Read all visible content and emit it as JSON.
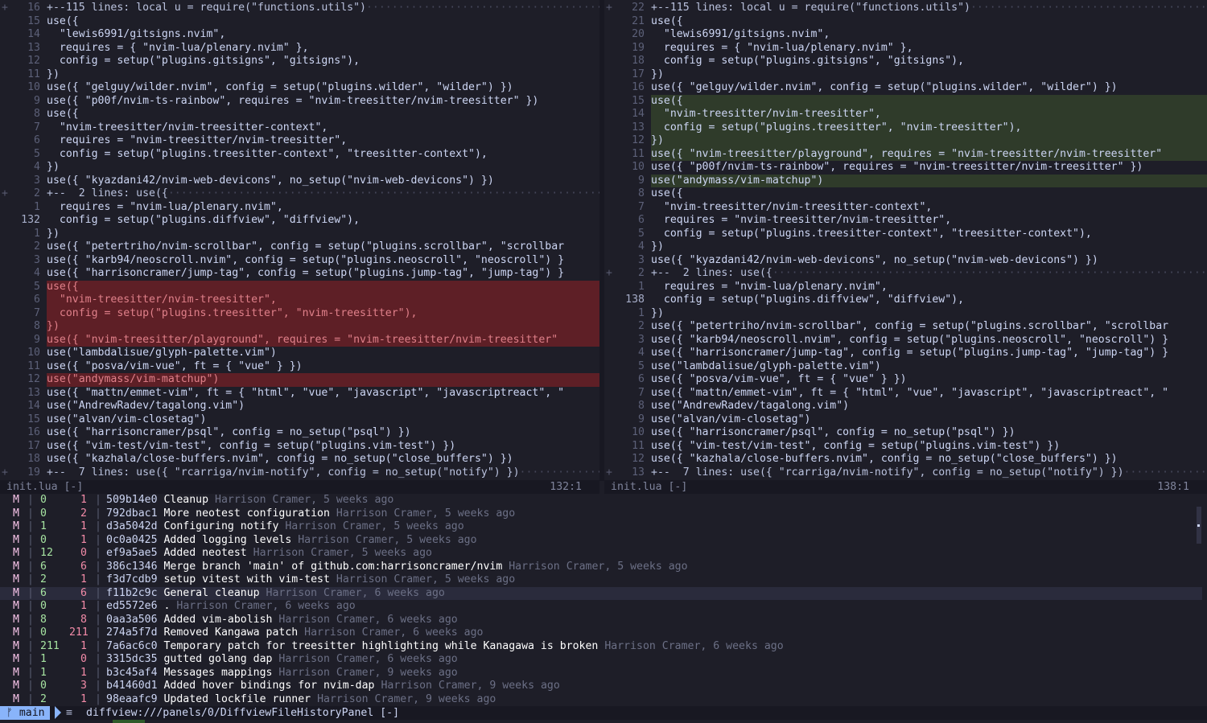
{
  "left": {
    "lines": [
      {
        "sign": "+",
        "num": "16",
        "code": "+--115 lines: local u = require(\"functions.utils\")",
        "type": "fold"
      },
      {
        "sign": "",
        "num": "15",
        "code": "use({",
        "type": ""
      },
      {
        "sign": "",
        "num": "14",
        "code": "  \"lewis6991/gitsigns.nvim\",",
        "type": ""
      },
      {
        "sign": "",
        "num": "13",
        "code": "  requires = { \"nvim-lua/plenary.nvim\" },",
        "type": ""
      },
      {
        "sign": "",
        "num": "12",
        "code": "  config = setup(\"plugins.gitsigns\", \"gitsigns\"),",
        "type": ""
      },
      {
        "sign": "",
        "num": "11",
        "code": "})",
        "type": ""
      },
      {
        "sign": "",
        "num": "10",
        "code": "use({ \"gelguy/wilder.nvim\", config = setup(\"plugins.wilder\", \"wilder\") })",
        "type": ""
      },
      {
        "sign": "",
        "num": "9",
        "code": "use({ \"p00f/nvim-ts-rainbow\", requires = \"nvim-treesitter/nvim-treesitter\" })",
        "type": ""
      },
      {
        "sign": "",
        "num": "8",
        "code": "use({",
        "type": ""
      },
      {
        "sign": "",
        "num": "7",
        "code": "  \"nvim-treesitter/nvim-treesitter-context\",",
        "type": ""
      },
      {
        "sign": "",
        "num": "6",
        "code": "  requires = \"nvim-treesitter/nvim-treesitter\",",
        "type": ""
      },
      {
        "sign": "",
        "num": "5",
        "code": "  config = setup(\"plugins.treesitter-context\", \"treesitter-context\"),",
        "type": ""
      },
      {
        "sign": "",
        "num": "4",
        "code": "})",
        "type": ""
      },
      {
        "sign": "",
        "num": "3",
        "code": "use({ \"kyazdani42/nvim-web-devicons\", no_setup(\"nvim-web-devicons\") })",
        "type": ""
      },
      {
        "sign": "+",
        "num": "2",
        "code": "+--  2 lines: use({",
        "type": "fold"
      },
      {
        "sign": "",
        "num": "1",
        "code": "  requires = \"nvim-lua/plenary.nvim\",",
        "type": ""
      },
      {
        "sign": "",
        "num": "132",
        "code": "  config = setup(\"plugins.diffview\", \"diffview\"),",
        "type": "cur"
      },
      {
        "sign": "",
        "num": "1",
        "code": "})",
        "type": ""
      },
      {
        "sign": "",
        "num": "2",
        "code": "use({ \"petertriho/nvim-scrollbar\", config = setup(\"plugins.scrollbar\", \"scrollbar",
        "type": ""
      },
      {
        "sign": "",
        "num": "3",
        "code": "use({ \"karb94/neoscroll.nvim\", config = setup(\"plugins.neoscroll\", \"neoscroll\") }",
        "type": ""
      },
      {
        "sign": "",
        "num": "4",
        "code": "use({ \"harrisoncramer/jump-tag\", config = setup(\"plugins.jump-tag\", \"jump-tag\") }",
        "type": ""
      },
      {
        "sign": "",
        "num": "5",
        "code": "use({",
        "type": "del"
      },
      {
        "sign": "",
        "num": "6",
        "code": "  \"nvim-treesitter/nvim-treesitter\",",
        "type": "del"
      },
      {
        "sign": "",
        "num": "7",
        "code": "  config = setup(\"plugins.treesitter\", \"nvim-treesitter\"),",
        "type": "del"
      },
      {
        "sign": "",
        "num": "8",
        "code": "})",
        "type": "del"
      },
      {
        "sign": "",
        "num": "9",
        "code": "use({ \"nvim-treesitter/playground\", requires = \"nvim-treesitter/nvim-treesitter\"",
        "type": "del"
      },
      {
        "sign": "",
        "num": "10",
        "code": "use(\"lambdalisue/glyph-palette.vim\")",
        "type": ""
      },
      {
        "sign": "",
        "num": "11",
        "code": "use({ \"posva/vim-vue\", ft = { \"vue\" } })",
        "type": ""
      },
      {
        "sign": "",
        "num": "12",
        "code": "use(\"andymass/vim-matchup\")",
        "type": "del"
      },
      {
        "sign": "",
        "num": "13",
        "code": "use({ \"mattn/emmet-vim\", ft = { \"html\", \"vue\", \"javascript\", \"javascriptreact\", \"",
        "type": ""
      },
      {
        "sign": "",
        "num": "14",
        "code": "use(\"AndrewRadev/tagalong.vim\")",
        "type": ""
      },
      {
        "sign": "",
        "num": "15",
        "code": "use(\"alvan/vim-closetag\")",
        "type": ""
      },
      {
        "sign": "",
        "num": "16",
        "code": "use({ \"harrisoncramer/psql\", config = no_setup(\"psql\") })",
        "type": ""
      },
      {
        "sign": "",
        "num": "17",
        "code": "use({ \"vim-test/vim-test\", config = setup(\"plugins.vim-test\") })",
        "type": ""
      },
      {
        "sign": "",
        "num": "18",
        "code": "use({ \"kazhala/close-buffers.nvim\", config = no_setup(\"close_buffers\") })",
        "type": ""
      },
      {
        "sign": "+",
        "num": "19",
        "code": "+--  7 lines: use({ \"rcarriga/nvim-notify\", config = no_setup(\"notify\") })",
        "type": "fold"
      }
    ],
    "status": {
      "file": "init.lua [-]",
      "pos": "132:1"
    }
  },
  "right": {
    "lines": [
      {
        "sign": "+",
        "num": "22",
        "code": "+--115 lines: local u = require(\"functions.utils\")",
        "type": "fold"
      },
      {
        "sign": "",
        "num": "21",
        "code": "use({",
        "type": ""
      },
      {
        "sign": "",
        "num": "20",
        "code": "  \"lewis6991/gitsigns.nvim\",",
        "type": ""
      },
      {
        "sign": "",
        "num": "19",
        "code": "  requires = { \"nvim-lua/plenary.nvim\" },",
        "type": ""
      },
      {
        "sign": "",
        "num": "18",
        "code": "  config = setup(\"plugins.gitsigns\", \"gitsigns\"),",
        "type": ""
      },
      {
        "sign": "",
        "num": "17",
        "code": "})",
        "type": ""
      },
      {
        "sign": "",
        "num": "16",
        "code": "use({ \"gelguy/wilder.nvim\", config = setup(\"plugins.wilder\", \"wilder\") })",
        "type": ""
      },
      {
        "sign": "",
        "num": "15",
        "code": "use({",
        "type": "add"
      },
      {
        "sign": "",
        "num": "14",
        "code": "  \"nvim-treesitter/nvim-treesitter\",",
        "type": "add"
      },
      {
        "sign": "",
        "num": "13",
        "code": "  config = setup(\"plugins.treesitter\", \"nvim-treesitter\"),",
        "type": "add"
      },
      {
        "sign": "",
        "num": "12",
        "code": "})",
        "type": "add"
      },
      {
        "sign": "",
        "num": "11",
        "code": "use({ \"nvim-treesitter/playground\", requires = \"nvim-treesitter/nvim-treesitter\"",
        "type": "add"
      },
      {
        "sign": "",
        "num": "10",
        "code": "use({ \"p00f/nvim-ts-rainbow\", requires = \"nvim-treesitter/nvim-treesitter\" })",
        "type": ""
      },
      {
        "sign": "",
        "num": "9",
        "code": "use(\"andymass/vim-matchup\")",
        "type": "add"
      },
      {
        "sign": "",
        "num": "8",
        "code": "use({",
        "type": ""
      },
      {
        "sign": "",
        "num": "7",
        "code": "  \"nvim-treesitter/nvim-treesitter-context\",",
        "type": ""
      },
      {
        "sign": "",
        "num": "6",
        "code": "  requires = \"nvim-treesitter/nvim-treesitter\",",
        "type": ""
      },
      {
        "sign": "",
        "num": "5",
        "code": "  config = setup(\"plugins.treesitter-context\", \"treesitter-context\"),",
        "type": ""
      },
      {
        "sign": "",
        "num": "4",
        "code": "})",
        "type": ""
      },
      {
        "sign": "",
        "num": "3",
        "code": "use({ \"kyazdani42/nvim-web-devicons\", no_setup(\"nvim-web-devicons\") })",
        "type": ""
      },
      {
        "sign": "+",
        "num": "2",
        "code": "+--  2 lines: use({",
        "type": "fold"
      },
      {
        "sign": "",
        "num": "1",
        "code": "  requires = \"nvim-lua/plenary.nvim\",",
        "type": ""
      },
      {
        "sign": "",
        "num": "138",
        "code": "  config = setup(\"plugins.diffview\", \"diffview\"),",
        "type": "cur"
      },
      {
        "sign": "",
        "num": "1",
        "code": "})",
        "type": ""
      },
      {
        "sign": "",
        "num": "2",
        "code": "use({ \"petertriho/nvim-scrollbar\", config = setup(\"plugins.scrollbar\", \"scrollbar",
        "type": ""
      },
      {
        "sign": "",
        "num": "3",
        "code": "use({ \"karb94/neoscroll.nvim\", config = setup(\"plugins.neoscroll\", \"neoscroll\") }",
        "type": ""
      },
      {
        "sign": "",
        "num": "4",
        "code": "use({ \"harrisoncramer/jump-tag\", config = setup(\"plugins.jump-tag\", \"jump-tag\") }",
        "type": ""
      },
      {
        "sign": "",
        "num": "5",
        "code": "use(\"lambdalisue/glyph-palette.vim\")",
        "type": ""
      },
      {
        "sign": "",
        "num": "6",
        "code": "use({ \"posva/vim-vue\", ft = { \"vue\" } })",
        "type": ""
      },
      {
        "sign": "",
        "num": "7",
        "code": "use({ \"mattn/emmet-vim\", ft = { \"html\", \"vue\", \"javascript\", \"javascriptreact\", \"",
        "type": ""
      },
      {
        "sign": "",
        "num": "8",
        "code": "use(\"AndrewRadev/tagalong.vim\")",
        "type": ""
      },
      {
        "sign": "",
        "num": "9",
        "code": "use(\"alvan/vim-closetag\")",
        "type": ""
      },
      {
        "sign": "",
        "num": "10",
        "code": "use({ \"harrisoncramer/psql\", config = no_setup(\"psql\") })",
        "type": ""
      },
      {
        "sign": "",
        "num": "11",
        "code": "use({ \"vim-test/vim-test\", config = setup(\"plugins.vim-test\") })",
        "type": ""
      },
      {
        "sign": "",
        "num": "12",
        "code": "use({ \"kazhala/close-buffers.nvim\", config = no_setup(\"close_buffers\") })",
        "type": ""
      },
      {
        "sign": "+",
        "num": "13",
        "code": "+--  7 lines: use({ \"rcarriga/nvim-notify\", config = no_setup(\"notify\") })",
        "type": "fold"
      }
    ],
    "status": {
      "file": "init.lua [-]",
      "pos": "138:1"
    }
  },
  "log": {
    "commits": [
      {
        "status": "M",
        "add": "0",
        "del": "1",
        "hash": "509b14e0",
        "subject": "Cleanup",
        "meta": "Harrison Cramer, 5 weeks ago"
      },
      {
        "status": "M",
        "add": "0",
        "del": "2",
        "hash": "792dbac1",
        "subject": "More neotest configuration",
        "meta": "Harrison Cramer, 5 weeks ago"
      },
      {
        "status": "M",
        "add": "1",
        "del": "1",
        "hash": "d3a5042d",
        "subject": "Configuring notify",
        "meta": "Harrison Cramer, 5 weeks ago"
      },
      {
        "status": "M",
        "add": "0",
        "del": "1",
        "hash": "0c0a0425",
        "subject": "Added logging levels",
        "meta": "Harrison Cramer, 5 weeks ago"
      },
      {
        "status": "M",
        "add": "12",
        "del": "0",
        "hash": "ef9a5ae5",
        "subject": "Added neotest",
        "meta": "Harrison Cramer, 5 weeks ago"
      },
      {
        "status": "M",
        "add": "6",
        "del": "6",
        "hash": "386c1346",
        "subject": "Merge branch 'main' of github.com:harrisoncramer/nvim",
        "meta": "Harrison Cramer, 5 weeks ago"
      },
      {
        "status": "M",
        "add": "2",
        "del": "1",
        "hash": "f3d7cdb9",
        "subject": "setup vitest with vim-test",
        "meta": "Harrison Cramer, 5 weeks ago"
      },
      {
        "status": "M",
        "add": "6",
        "del": "6",
        "hash": "f11b2c9c",
        "subject": "General cleanup",
        "meta": "Harrison Cramer, 6 weeks ago",
        "selected": true
      },
      {
        "status": "M",
        "add": "0",
        "del": "1",
        "hash": "ed5572e6",
        "subject": ".",
        "meta": "Harrison Cramer, 6 weeks ago"
      },
      {
        "status": "M",
        "add": "8",
        "del": "8",
        "hash": "0aa3a506",
        "subject": "Added vim-abolish",
        "meta": "Harrison Cramer, 6 weeks ago"
      },
      {
        "status": "M",
        "add": "0",
        "del": "211",
        "hash": "274a5f7d",
        "subject": "Removed Kangawa patch",
        "meta": "Harrison Cramer, 6 weeks ago"
      },
      {
        "status": "M",
        "add": "211",
        "del": "1",
        "hash": "7a6ac6c0",
        "subject": "Temporary patch for treesitter highlighting while Kanagawa is broken",
        "meta": "Harrison Cramer, 6 weeks ago"
      },
      {
        "status": "M",
        "add": "1",
        "del": "0",
        "hash": "3315dc35",
        "subject": "gutted golang dap",
        "meta": "Harrison Cramer, 6 weeks ago"
      },
      {
        "status": "M",
        "add": "1",
        "del": "1",
        "hash": "b3c45af4",
        "subject": "Messages mappings",
        "meta": "Harrison Cramer, 9 weeks ago"
      },
      {
        "status": "M",
        "add": "0",
        "del": "3",
        "hash": "b41460d1",
        "subject": "Added hover bindings for nvim-dap",
        "meta": "Harrison Cramer, 9 weeks ago"
      },
      {
        "status": "M",
        "add": "2",
        "del": "1",
        "hash": "98eaafc9",
        "subject": "Updated lockfile runner",
        "meta": "Harrison Cramer, 9 weeks ago"
      }
    ]
  },
  "bottombar": {
    "branch_icon": "git-branch-icon",
    "branch": " main",
    "panel_icon": "list-icon",
    "panel_icon_glyph": "≡",
    "panel_path": "diffview:///panels/0/DiffviewFileHistoryPanel [-]"
  },
  "colors": {
    "deleted_bg": "#5e1f26",
    "added_bg": "#2f3b2a",
    "branch_accent": "#89b4fa",
    "status_modified": "#f5c2e7"
  }
}
